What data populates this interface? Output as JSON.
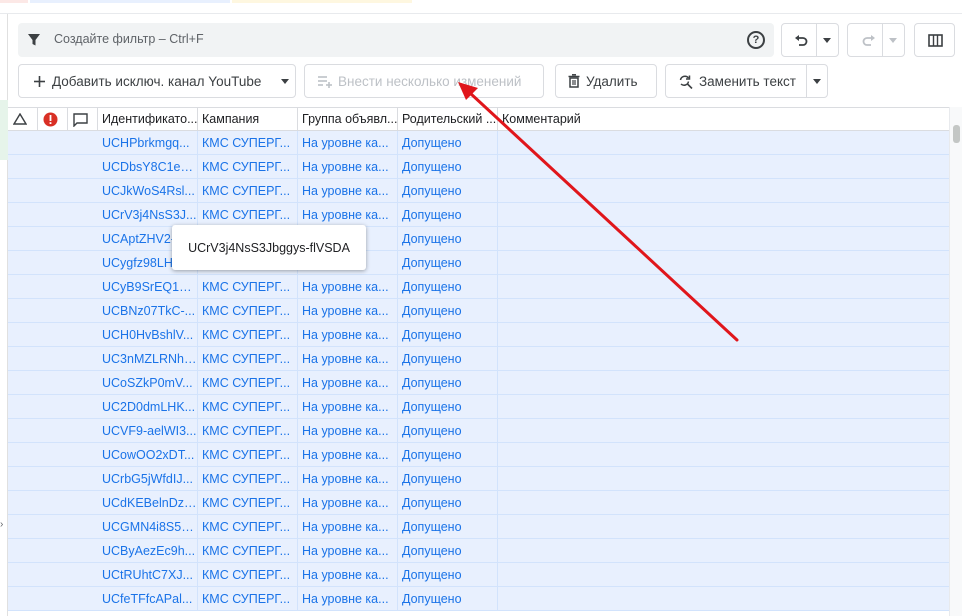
{
  "filter": {
    "placeholder": "Создайте фильтр – Ctrl+F",
    "help_glyph": "?"
  },
  "toolbar": {
    "add_label": "Добавить исключ. канал YouTube",
    "bulk_edit_label": "Внести несколько изменений",
    "delete_label": "Удалить",
    "replace_label": "Заменить текст"
  },
  "table": {
    "headers": {
      "identifier": "Идентификато...",
      "campaign": "Кампания",
      "ad_group": "Группа объявл...",
      "parent": "Родительский ...",
      "comment": "Комментарий"
    },
    "rows": [
      {
        "id": "UCHPbrkmgq...",
        "campaign": "КМС СУПЕРГ...",
        "group": "На уровне ка...",
        "status": "Допущено"
      },
      {
        "id": "UCDbsY8C1eQ...",
        "campaign": "КМС СУПЕРГ...",
        "group": "На уровне ка...",
        "status": "Допущено"
      },
      {
        "id": "UCJkWoS4Rsl...",
        "campaign": "КМС СУПЕРГ...",
        "group": "На уровне ка...",
        "status": "Допущено"
      },
      {
        "id": "UCrV3j4NsS3J...",
        "campaign": "КМС СУПЕРГ...",
        "group": "На уровне ка...",
        "status": "Допущено"
      },
      {
        "id": "UCAptZHV2-...",
        "campaign": "",
        "group": "",
        "status": "Допущено"
      },
      {
        "id": "UCygfz98LH...",
        "campaign": "",
        "group": "",
        "status": "Допущено"
      },
      {
        "id": "UCyB9SrEQ1KI...",
        "campaign": "КМС СУПЕРГ...",
        "group": "На уровне ка...",
        "status": "Допущено"
      },
      {
        "id": "UCBNz07TkC-...",
        "campaign": "КМС СУПЕРГ...",
        "group": "На уровне ка...",
        "status": "Допущено"
      },
      {
        "id": "UCH0HvBshlV...",
        "campaign": "КМС СУПЕРГ...",
        "group": "На уровне ка...",
        "status": "Допущено"
      },
      {
        "id": "UC3nMZLRNh-...",
        "campaign": "КМС СУПЕРГ...",
        "group": "На уровне ка...",
        "status": "Допущено"
      },
      {
        "id": "UCoSZkP0mV...",
        "campaign": "КМС СУПЕРГ...",
        "group": "На уровне ка...",
        "status": "Допущено"
      },
      {
        "id": "UC2D0dmLHK...",
        "campaign": "КМС СУПЕРГ...",
        "group": "На уровне ка...",
        "status": "Допущено"
      },
      {
        "id": "UCVF9-aelWI3...",
        "campaign": "КМС СУПЕРГ...",
        "group": "На уровне ка...",
        "status": "Допущено"
      },
      {
        "id": "UCowOO2xDT...",
        "campaign": "КМС СУПЕРГ...",
        "group": "На уровне ка...",
        "status": "Допущено"
      },
      {
        "id": "UCrbG5jWfdIJ...",
        "campaign": "КМС СУПЕРГ...",
        "group": "На уровне ка...",
        "status": "Допущено"
      },
      {
        "id": "UCdKEBelnDzi...",
        "campaign": "КМС СУПЕРГ...",
        "group": "На уровне ка...",
        "status": "Допущено"
      },
      {
        "id": "UCGMN4i8S50...",
        "campaign": "КМС СУПЕРГ...",
        "group": "На уровне ка...",
        "status": "Допущено"
      },
      {
        "id": "UCByAezEc9h...",
        "campaign": "КМС СУПЕРГ...",
        "group": "На уровне ка...",
        "status": "Допущено"
      },
      {
        "id": "UCtRUhtC7XJ...",
        "campaign": "КМС СУПЕРГ...",
        "group": "На уровне ка...",
        "status": "Допущено"
      },
      {
        "id": "UCfeTFfcAPal...",
        "campaign": "КМС СУПЕРГ...",
        "group": "На уровне ка...",
        "status": "Допущено"
      }
    ]
  },
  "tooltip": {
    "text": "UCrV3j4NsS3Jbggys-flVSDA"
  },
  "colors": {
    "link": "#1a73e8",
    "row_selected": "#e8f0fe",
    "error": "#d93025",
    "annotation_arrow": "#e0161b"
  },
  "icons": {
    "filter": "funnel-icon",
    "help": "help-circle-icon",
    "undo": "undo-icon",
    "redo": "redo-icon",
    "columns": "columns-icon",
    "add": "plus-icon",
    "bulk_edit": "playlist-add-icon",
    "delete": "trash-icon",
    "replace": "find-replace-icon",
    "warning": "triangle-icon",
    "error": "error-icon",
    "comment": "comment-icon"
  }
}
